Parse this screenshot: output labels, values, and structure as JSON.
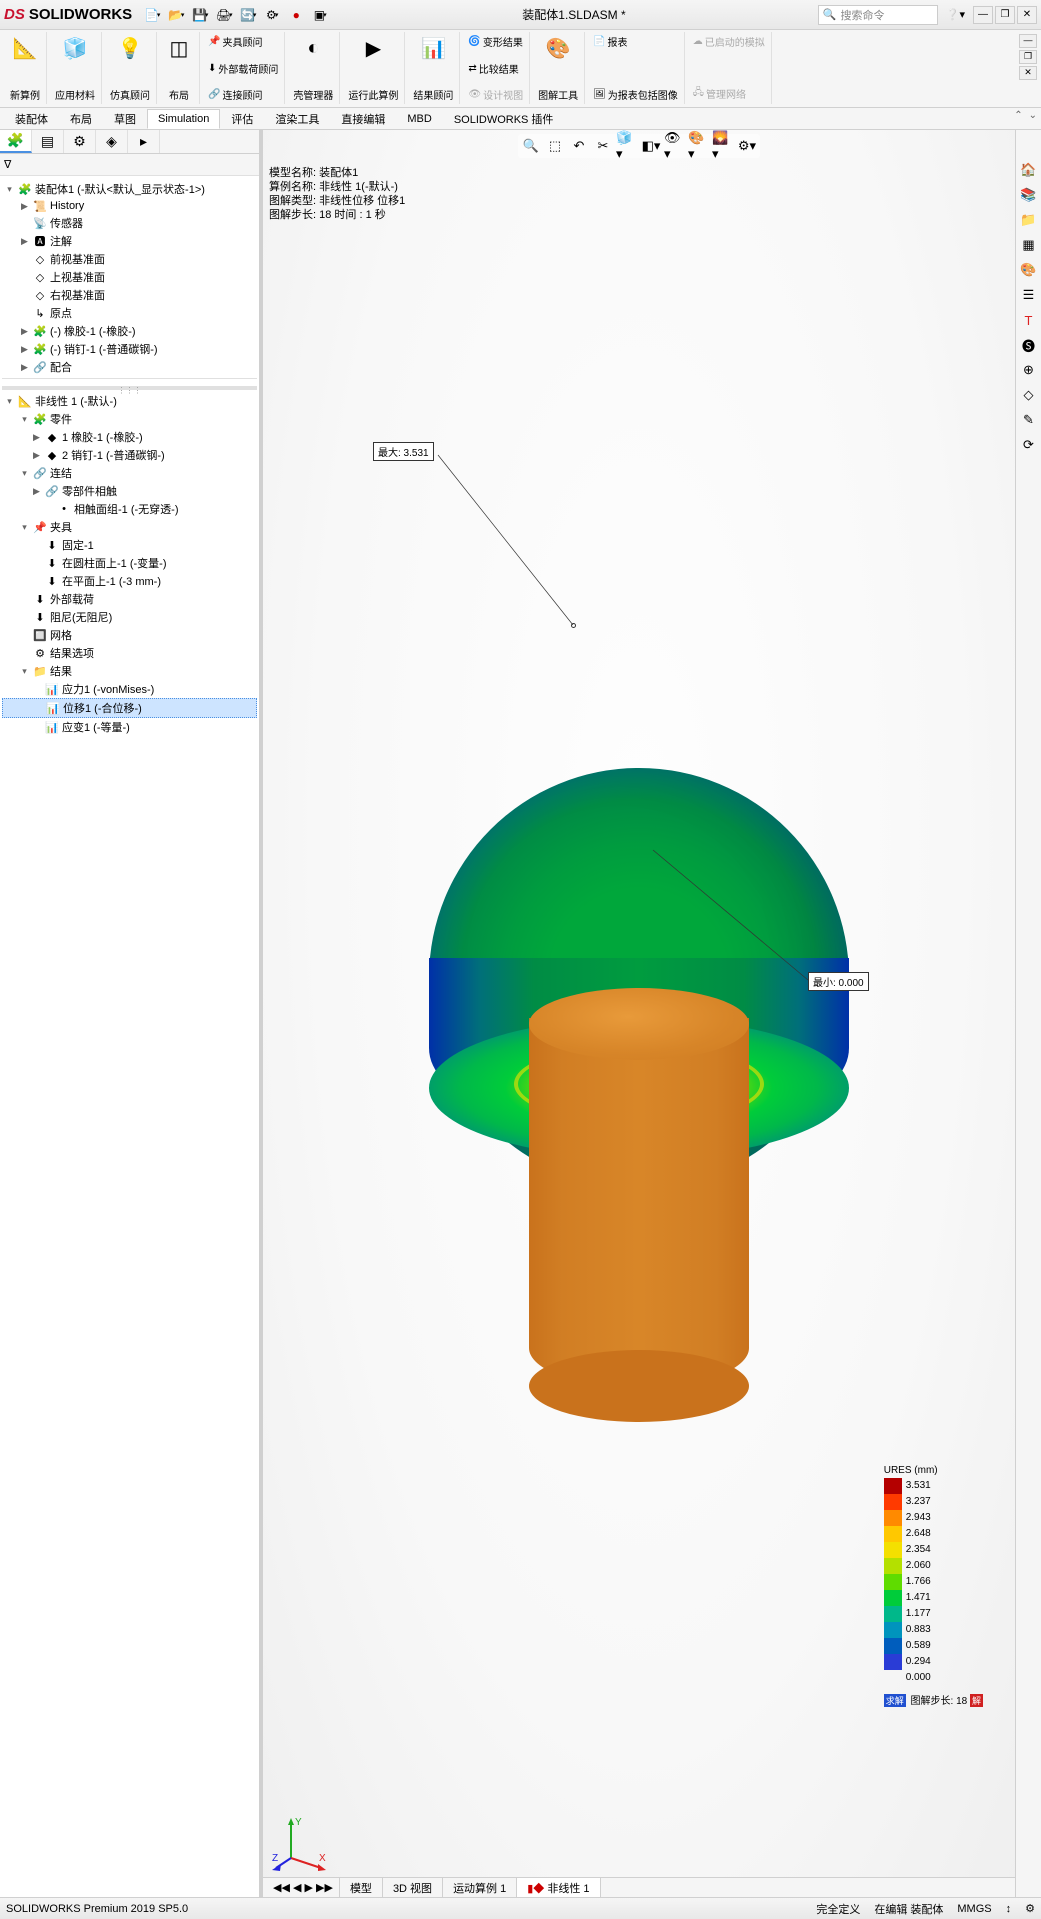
{
  "app": {
    "brand_ds": "DS",
    "brand_sw": "SOLIDWORKS",
    "document": "装配体1.SLDASM *",
    "search_placeholder": "搜索命令"
  },
  "ribbon": {
    "groups": [
      {
        "id": "new-study",
        "label": "新算例"
      },
      {
        "id": "apply-material",
        "label": "应用材料"
      },
      {
        "id": "sim-advisor",
        "label": "仿真顾问"
      },
      {
        "id": "layout",
        "label": "布局"
      }
    ],
    "items": {
      "fixture": "夹具顾问",
      "ext_load": "外部载荷顾问",
      "connection": "连接顾问",
      "shell_mgr": "壳管理器",
      "run_case": "运行此算例",
      "results_adv": "结果顾问",
      "deformed": "变形结果",
      "compare": "比较结果",
      "design_insight": "设计视图",
      "plot_tools": "图解工具",
      "report": "报表",
      "incl_img": "为报表包括图像",
      "auto_sim": "已启动的模拟",
      "manage_net": "管理网络"
    },
    "tabs": [
      "装配体",
      "布局",
      "草图",
      "Simulation",
      "评估",
      "渲染工具",
      "直接编辑",
      "MBD",
      "SOLIDWORKS 插件"
    ],
    "active_tab": 3
  },
  "panel_tabs": [
    "feature-tree",
    "property",
    "config",
    "display",
    "simulation"
  ],
  "filter_label": "筛选",
  "tree": {
    "root": "装配体1 (-默认<默认_显示状态-1>)",
    "nodes": [
      {
        "d": 1,
        "t": "▶",
        "i": "📜",
        "txt": "History"
      },
      {
        "d": 1,
        "t": "",
        "i": "📡",
        "txt": "传感器"
      },
      {
        "d": 1,
        "t": "▶",
        "i": "🅰",
        "txt": "注解"
      },
      {
        "d": 1,
        "t": "",
        "i": "◇",
        "txt": "前视基准面"
      },
      {
        "d": 1,
        "t": "",
        "i": "◇",
        "txt": "上视基准面"
      },
      {
        "d": 1,
        "t": "",
        "i": "◇",
        "txt": "右视基准面"
      },
      {
        "d": 1,
        "t": "",
        "i": "↳",
        "txt": "原点"
      },
      {
        "d": 1,
        "t": "▶",
        "i": "🧩",
        "txt": "(-) 橡胶-1 (-橡胶-)"
      },
      {
        "d": 1,
        "t": "▶",
        "i": "🧩",
        "txt": "(-) 销钉-1 (-普通碳钢-)"
      },
      {
        "d": 1,
        "t": "▶",
        "i": "🔗",
        "txt": "配合"
      }
    ],
    "study_root": "非线性 1 (-默认-)",
    "study_nodes": [
      {
        "d": 1,
        "t": "▾",
        "i": "🧩",
        "txt": "零件"
      },
      {
        "d": 2,
        "t": "▶",
        "i": "◆",
        "txt": "1 橡胶-1 (-橡胶-)"
      },
      {
        "d": 2,
        "t": "▶",
        "i": "◆",
        "txt": "2 销钉-1 (-普通碳钢-)"
      },
      {
        "d": 1,
        "t": "▾",
        "i": "🔗",
        "txt": "连结"
      },
      {
        "d": 2,
        "t": "▶",
        "i": "🔗",
        "txt": "零部件相触"
      },
      {
        "d": 3,
        "t": "",
        "i": "•",
        "txt": "相触面组-1 (-无穿透-)"
      },
      {
        "d": 1,
        "t": "▾",
        "i": "📌",
        "txt": "夹具"
      },
      {
        "d": 2,
        "t": "",
        "i": "⬇",
        "txt": "固定-1"
      },
      {
        "d": 2,
        "t": "",
        "i": "⬇",
        "txt": "在圆柱面上-1 (-变量-)"
      },
      {
        "d": 2,
        "t": "",
        "i": "⬇",
        "txt": "在平面上-1 (-3 mm-)"
      },
      {
        "d": 1,
        "t": "",
        "i": "⬇",
        "txt": "外部载荷"
      },
      {
        "d": 1,
        "t": "",
        "i": "⬇",
        "txt": "阻尼(无阻尼)"
      },
      {
        "d": 1,
        "t": "",
        "i": "🔲",
        "txt": "网格"
      },
      {
        "d": 1,
        "t": "",
        "i": "⚙",
        "txt": "结果选项"
      },
      {
        "d": 1,
        "t": "▾",
        "i": "📁",
        "txt": "结果"
      },
      {
        "d": 2,
        "t": "",
        "i": "📊",
        "txt": "应力1 (-vonMises-)"
      },
      {
        "d": 2,
        "t": "",
        "i": "📊",
        "txt": "位移1 (-合位移-)",
        "sel": true
      },
      {
        "d": 2,
        "t": "",
        "i": "📊",
        "txt": "应变1 (-等量-)"
      }
    ]
  },
  "viewport": {
    "info_lines": [
      "模型名称: 装配体1",
      "算例名称: 非线性 1(-默认-)",
      "图解类型: 非线性位移 位移1",
      "图解步长: 18 时间 : 1 秒"
    ],
    "probe_max": "最大: 3.531",
    "probe_min": "最小: 0.000"
  },
  "chart_data": {
    "type": "colorbar",
    "title": "URES (mm)",
    "values": [
      3.531,
      3.237,
      2.943,
      2.648,
      2.354,
      2.06,
      1.766,
      1.471,
      1.177,
      0.883,
      0.589,
      0.294,
      0.0
    ],
    "colors": [
      "#b40000",
      "#ff3a00",
      "#ff8a00",
      "#ffc800",
      "#f4e000",
      "#b4e000",
      "#5fdc00",
      "#00cc3a",
      "#00b88a",
      "#0094bd",
      "#005dbd",
      "#2a3cd6",
      "#0020a8"
    ],
    "footer_prefix": "图解步长: 18",
    "badge_left": "求解",
    "badge_right": "解"
  },
  "triad": {
    "x": "X",
    "y": "Y",
    "z": "Z"
  },
  "bottom_tabs": [
    "模型",
    "3D 视图",
    "运动算例 1",
    "非线性 1"
  ],
  "status": {
    "left": "SOLIDWORKS Premium 2019 SP5.0",
    "mid1": "完全定义",
    "mid2": "在编辑 装配体",
    "units": "MMGS"
  }
}
